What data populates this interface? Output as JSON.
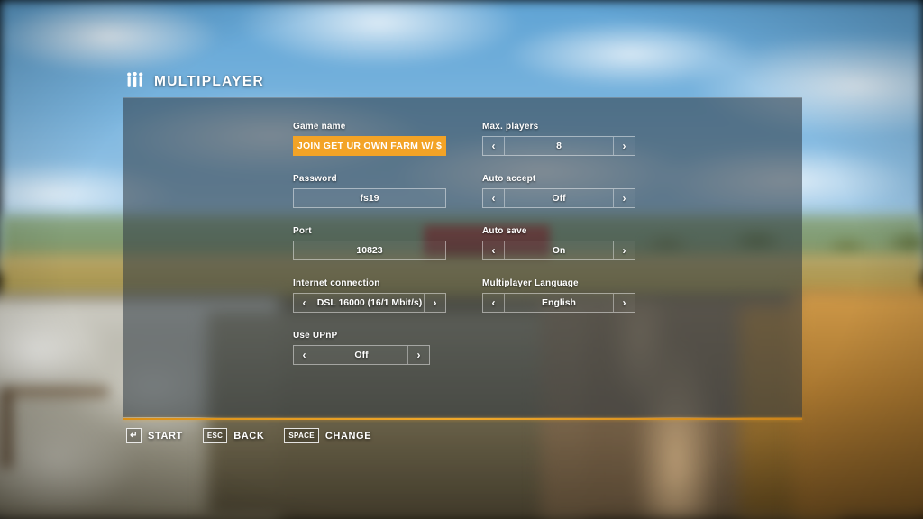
{
  "header": {
    "icon": "multiplayer-people-icon",
    "title": "MULTIPLAYER"
  },
  "form": {
    "left_column": [
      {
        "label": "Game name",
        "type": "text",
        "value": "JOIN GET UR OWN FARM W/ $",
        "focused": true
      },
      {
        "label": "Password",
        "type": "text",
        "value": "fs19",
        "focused": false
      },
      {
        "label": "Port",
        "type": "text",
        "value": "10823",
        "focused": false
      },
      {
        "label": "Internet connection",
        "type": "selector",
        "value": "DSL 16000 (16/1 Mbit/s)",
        "prev_icon": "chevron-left-icon",
        "next_icon": "chevron-right-icon"
      },
      {
        "label": "Use UPnP",
        "type": "selector",
        "value": "Off",
        "prev_icon": "chevron-left-icon",
        "next_icon": "chevron-right-icon"
      }
    ],
    "right_column": [
      {
        "label": "Max. players",
        "type": "selector",
        "value": "8",
        "prev_icon": "chevron-left-icon",
        "next_icon": "chevron-right-icon"
      },
      {
        "label": "Auto accept",
        "type": "selector",
        "value": "Off",
        "prev_icon": "chevron-left-icon",
        "next_icon": "chevron-right-icon"
      },
      {
        "label": "Auto save",
        "type": "selector",
        "value": "On",
        "prev_icon": "chevron-left-icon",
        "next_icon": "chevron-right-icon"
      },
      {
        "label": "Multiplayer Language",
        "type": "selector",
        "value": "English",
        "prev_icon": "chevron-left-icon",
        "next_icon": "chevron-right-icon"
      }
    ]
  },
  "footer": {
    "hints": [
      {
        "key": "↵",
        "action": "START"
      },
      {
        "key": "ESC",
        "action": "BACK"
      },
      {
        "key": "SPACE",
        "action": "CHANGE"
      }
    ]
  },
  "colors": {
    "accent_orange": "#f3a326",
    "panel_overlay": "rgba(46,56,66,0.55)",
    "text_white": "#ffffff"
  }
}
